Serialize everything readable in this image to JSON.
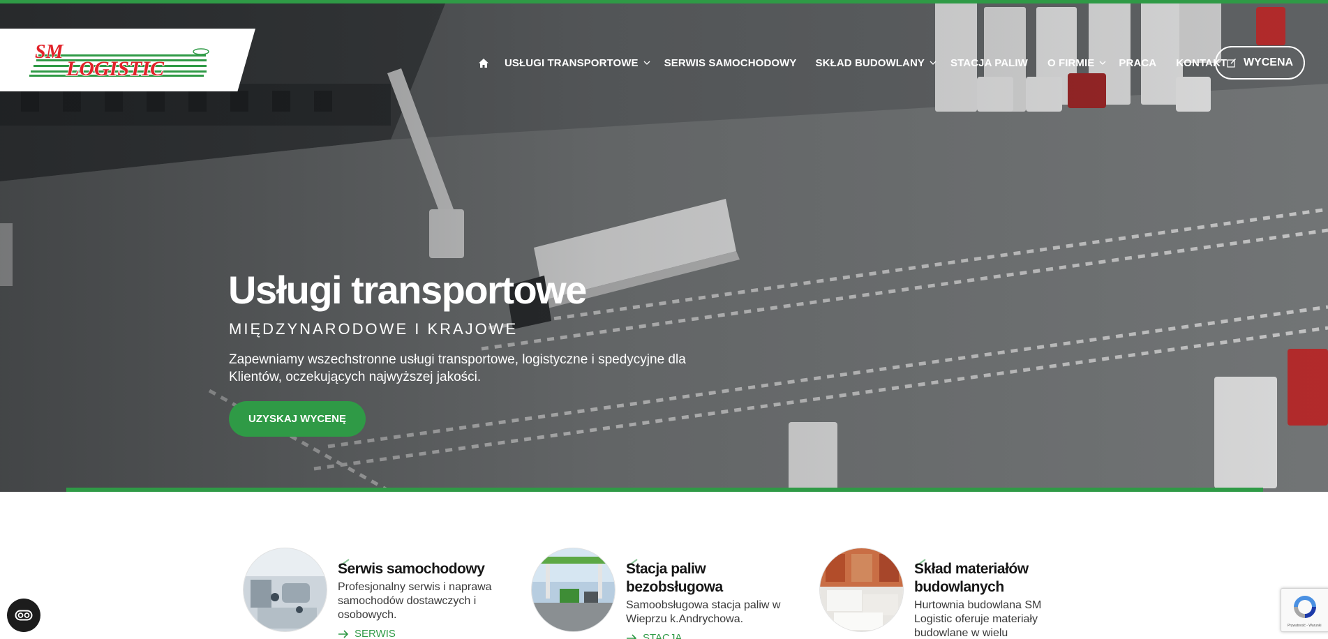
{
  "colors": {
    "brand_green": "#2f9a46",
    "brand_red": "#e2232a",
    "text_dark": "#161616"
  },
  "logo": {
    "line1": "SM",
    "line2": "LOGISTIC"
  },
  "nav": {
    "home_icon": "home-icon",
    "items": [
      {
        "label": "USŁUGI TRANSPORTOWE",
        "has_dropdown": true
      },
      {
        "label": "SERWIS SAMOCHODOWY",
        "has_dropdown": false
      },
      {
        "label": "SKŁAD BUDOWLANY",
        "has_dropdown": true
      },
      {
        "label": "STACJA PALIW",
        "has_dropdown": false
      },
      {
        "label": "O FIRMIE",
        "has_dropdown": true
      },
      {
        "label": "PRACA",
        "has_dropdown": false
      },
      {
        "label": "KONTAKT",
        "has_dropdown": false
      }
    ],
    "quote_button": {
      "label": "WYCENA",
      "icon": "edit-icon"
    }
  },
  "hero": {
    "title": "Usługi transportowe",
    "subtitle": "MIĘDZYNARODOWE I KRAJOWE",
    "text": "Zapewniamy wszechstronne usługi transportowe, logistyczne i spedycyjne dla Klientów, oczekujących najwyższej jakości.",
    "cta_label": "UZYSKAJ WYCENĘ"
  },
  "services": [
    {
      "title": "Serwis samochodowy",
      "description": "Profesjonalny serwis i naprawa samochodów dostawczych i osobowych.",
      "link_label": "SERWIS"
    },
    {
      "title": "Stacja paliw bezobsługowa",
      "description": "Samoobsługowa stacja paliw w Wieprzu k.Andrychowa.",
      "link_label": "STACJA"
    },
    {
      "title": "Skład materiałów budowlanych",
      "description": "Hurtownia budowlana SM Logistic oferuje materiały budowlane w wielu",
      "link_label": ""
    }
  ],
  "widgets": {
    "accessibility_icon": "accessibility-icon",
    "recaptcha_text": "Prywatność - Warunki"
  }
}
